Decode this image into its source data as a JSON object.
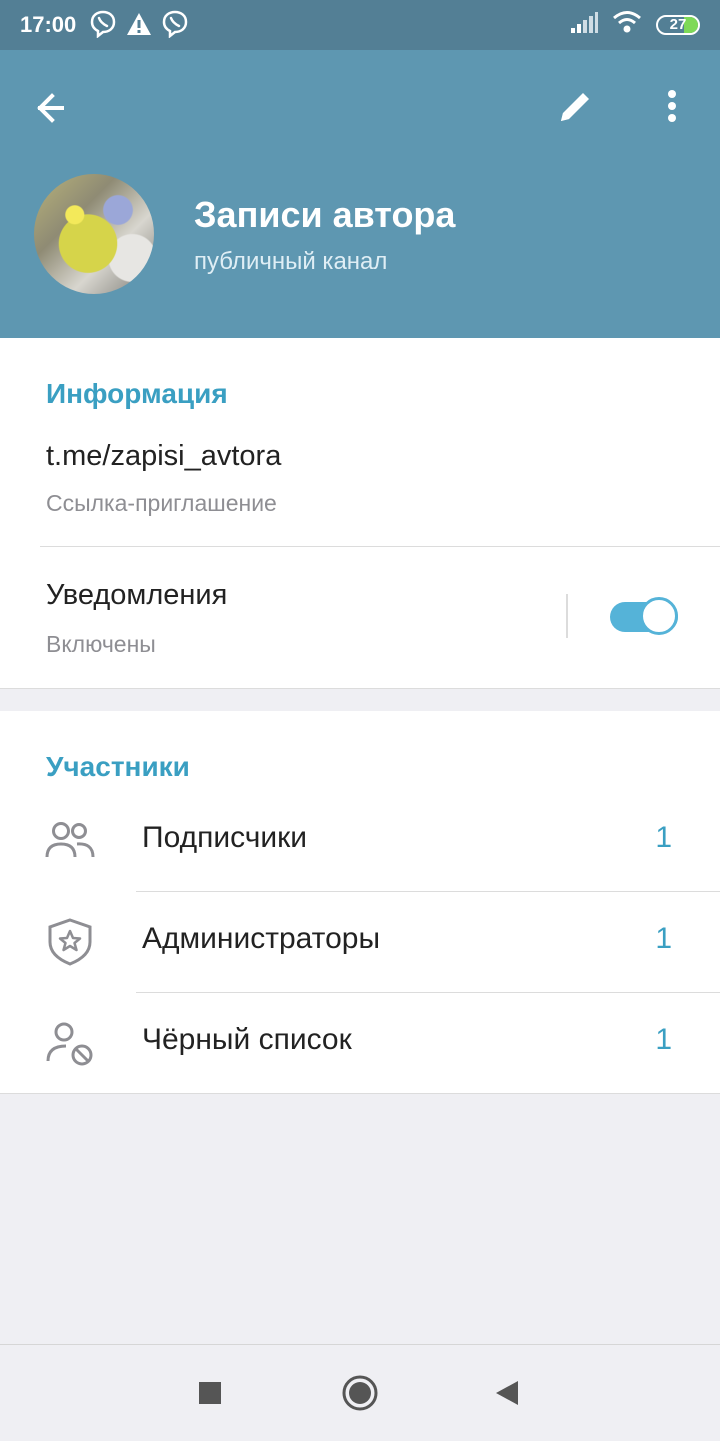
{
  "status_bar": {
    "time": "17:00",
    "notification_icons": [
      "viber-icon",
      "warning-icon",
      "viber-icon"
    ],
    "system_icons": [
      "signal-icon",
      "wifi-icon",
      "battery-icon"
    ],
    "battery_level": "27"
  },
  "header": {
    "back_icon": "arrow-left-icon",
    "edit_icon": "pencil-icon",
    "menu_icon": "more-vertical-icon",
    "channel_title": "Записи автора",
    "channel_subtitle": "публичный канал"
  },
  "info_section": {
    "title": "Информация",
    "link_value": "t.me/zapisi_avtora",
    "link_caption": "Ссылка-приглашение",
    "notifications_label": "Уведомления",
    "notifications_status": "Включены",
    "notifications_enabled": true
  },
  "members_section": {
    "title": "Участники",
    "rows": [
      {
        "label": "Подписчики",
        "count": "1",
        "icon": "users-icon"
      },
      {
        "label": "Администраторы",
        "count": "1",
        "icon": "shield-star-icon"
      },
      {
        "label": "Чёрный список",
        "count": "1",
        "icon": "user-blocked-icon"
      }
    ]
  },
  "colors": {
    "header": "#5e97b1",
    "status_bar": "#537f95",
    "accent": "#3a9fc2",
    "toggle": "#55b3d8"
  }
}
